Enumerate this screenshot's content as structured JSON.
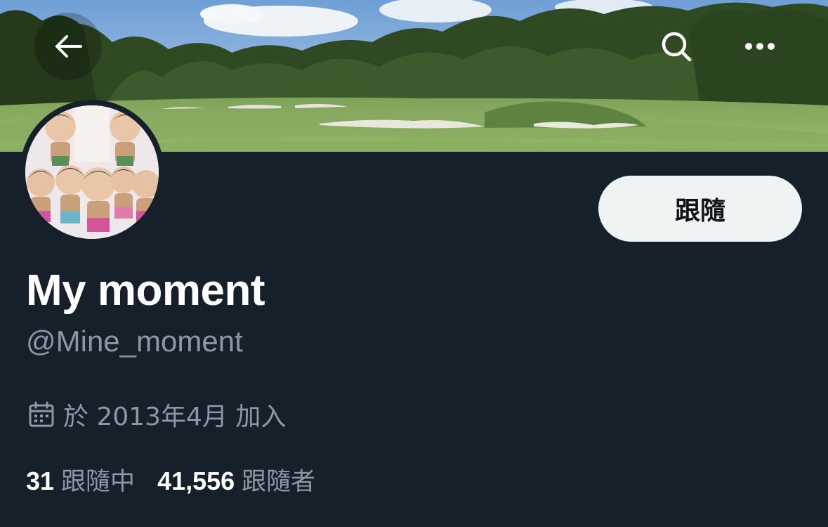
{
  "header": {
    "back_icon": "arrow-left-icon",
    "search_icon": "search-icon",
    "more_icon": "more-horizontal-icon"
  },
  "profile": {
    "display_name": "My moment",
    "handle": "@Mine_moment",
    "follow_button_label": "跟隨",
    "joined_icon": "calendar-icon",
    "joined_text": "於 2013年4月 加入",
    "following_count": "31",
    "following_label": "跟隨中",
    "followers_count": "41,556",
    "followers_label": "跟隨者"
  },
  "colors": {
    "background": "#15202b",
    "follow_button_bg": "#eff3f4",
    "secondary_text": "#8b98a5",
    "primary_text": "#ffffff"
  }
}
